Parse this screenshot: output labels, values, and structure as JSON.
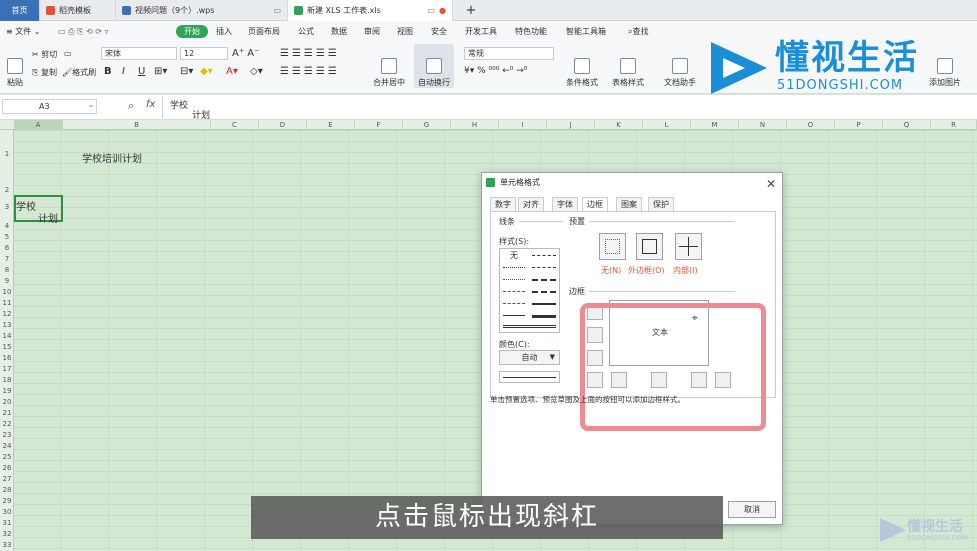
{
  "tabs": [
    {
      "label": "首页",
      "icon_color": "#3b6fb6"
    },
    {
      "label": "稻壳模板",
      "icon_color": "#e8512f"
    },
    {
      "label": "视频问题（9个）.wps",
      "icon_color": "#3b6fb6"
    },
    {
      "label": "新建 XLS 工作表.xls",
      "icon_color": "#2fa358"
    }
  ],
  "menu": {
    "file": "文件",
    "items": [
      "开始",
      "插入",
      "页面布局",
      "公式",
      "数据",
      "审阅",
      "视图",
      "安全",
      "开发工具",
      "特色功能",
      "智能工具箱"
    ],
    "search": "查找"
  },
  "ribbon": {
    "paste": "粘贴",
    "cut": "剪切",
    "copy": "复制",
    "format_painter": "格式刷",
    "font_name": "宋体",
    "font_size": "12",
    "merge_center": "合并居中",
    "wrap_text": "自动换行",
    "number_format": "常规",
    "cond_format": "条件格式",
    "table_style": "表格样式",
    "doc_assist": "文档助手",
    "add_image": "添加图片"
  },
  "formula": {
    "name_box": "A3",
    "fx": "fx",
    "content_line1": "学校",
    "content_line2": "计划"
  },
  "grid": {
    "columns": [
      "A",
      "B",
      "C",
      "D",
      "E",
      "F",
      "G",
      "H",
      "I",
      "J",
      "K",
      "L",
      "M",
      "N",
      "O",
      "P",
      "Q",
      "R"
    ],
    "rows": [
      "1",
      "2",
      "3",
      "4",
      "5",
      "6",
      "7",
      "8",
      "9",
      "10",
      "11",
      "12",
      "13",
      "14",
      "15",
      "16",
      "17",
      "18",
      "19",
      "20",
      "21",
      "22",
      "23",
      "24",
      "25",
      "26",
      "27",
      "28",
      "29",
      "30",
      "31",
      "32",
      "33",
      "34",
      "35",
      "36",
      "37"
    ],
    "b1": "学校培训计划",
    "a3_line1": "学校",
    "a3_line2": "计划"
  },
  "dialog": {
    "title": "单元格格式",
    "tabs": [
      "数字",
      "对齐",
      "字体",
      "边框",
      "图案",
      "保护"
    ],
    "line_section": "线条",
    "style_label": "样式(S):",
    "style_none": "无",
    "color_label": "颜色(C):",
    "color_value": "自动",
    "preset_section": "预置",
    "preset_none": "无(N)",
    "preset_outline": "外边框(O)",
    "preset_inside": "内部(I)",
    "border_section": "边框",
    "preview_text": "文本",
    "hint": "单击预置选项、预览草图及上面的按钮可以添加边框样式。",
    "cancel": "取消"
  },
  "subtitle": "点击鼠标出现斜杠",
  "watermark": {
    "title": "懂视生活",
    "url": "51DONGSHI.COM"
  },
  "colors": {
    "accent_green": "#2fa358",
    "highlight": "#ef8a92",
    "grid_bg": "#d4e8d4",
    "watermark_blue": "#1a8fd8"
  }
}
